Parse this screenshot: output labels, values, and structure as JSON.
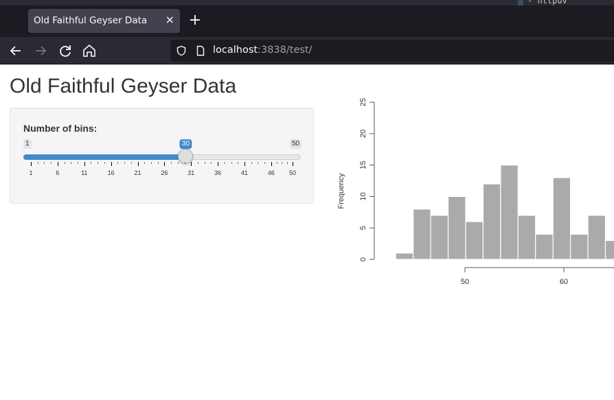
{
  "browser": {
    "terminal_fragment": "- httpuv",
    "tab": {
      "title": "Old Faithful Geyser Data",
      "close_label": "×"
    },
    "new_tab_label": "+",
    "url": {
      "host": "localhost",
      "rest": ":3838/test/"
    }
  },
  "page": {
    "title": "Old Faithful Geyser Data",
    "sidebar": {
      "label": "Number of bins:",
      "slider": {
        "min": 1,
        "max": 50,
        "value": 30,
        "min_label": "1",
        "max_label": "50",
        "value_label": "30",
        "tick_labels": [
          "1",
          "6",
          "11",
          "16",
          "21",
          "26",
          "31",
          "36",
          "41",
          "46",
          "50"
        ],
        "accent_color": "#428bca"
      }
    }
  },
  "chart_data": {
    "type": "bar",
    "title": "",
    "xlabel": "",
    "ylabel": "Frequency",
    "bin_start": 43,
    "bin_width": 1.7667,
    "values": [
      1,
      8,
      7,
      10,
      6,
      12,
      15,
      7,
      4,
      13,
      4,
      7,
      3
    ],
    "x_ticks": [
      50,
      60
    ],
    "x_tick_labels": [
      "50",
      "60"
    ],
    "y_ticks": [
      0,
      5,
      10,
      15,
      20,
      25
    ],
    "y_tick_labels": [
      "0",
      "5",
      "10",
      "15",
      "20",
      "25"
    ],
    "ylim": [
      0,
      25
    ],
    "bar_color": "#aaaaaa",
    "bar_border": "#ffffff",
    "grid": false
  }
}
